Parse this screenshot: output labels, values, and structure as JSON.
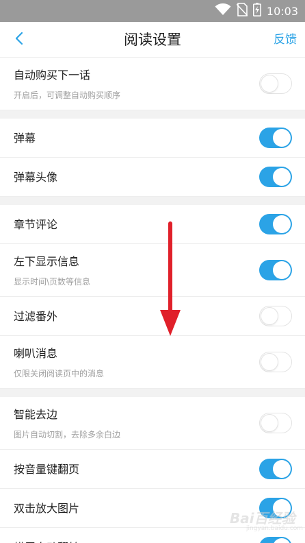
{
  "status_bar": {
    "time": "10:03",
    "icons": [
      "wifi-icon",
      "no-sim-icon",
      "battery-charging-icon"
    ]
  },
  "nav": {
    "back_icon": "chevron-left-icon",
    "title": "阅读设置",
    "feedback": "反馈"
  },
  "colors": {
    "accent": "#2ba3e6",
    "section_gap": "#f2f2f2",
    "status_bar": "#9a9a9a",
    "arrow": "#e0202a"
  },
  "settings": [
    {
      "label": "自动购买下一话",
      "sub": "开启后，可调整自动购买顺序",
      "on": false
    },
    {
      "label": "弹幕",
      "sub": "",
      "on": true
    },
    {
      "label": "弹幕头像",
      "sub": "",
      "on": true
    },
    {
      "label": "章节评论",
      "sub": "",
      "on": true
    },
    {
      "label": "左下显示信息",
      "sub": "显示时间\\页数等信息",
      "on": true
    },
    {
      "label": "过滤番外",
      "sub": "",
      "on": false
    },
    {
      "label": "喇叭消息",
      "sub": "仅限关闭阅读页中的消息",
      "on": false
    },
    {
      "label": "智能去边",
      "sub": "图片自动切割，去除多余白边",
      "on": false
    },
    {
      "label": "按音量键翻页",
      "sub": "",
      "on": true
    },
    {
      "label": "双击放大图片",
      "sub": "",
      "on": true
    },
    {
      "label": "横屏自动翻转",
      "sub": "",
      "on": true
    }
  ],
  "watermark": {
    "text": "Bai百经验",
    "sub": "jingyan.baidu.com"
  }
}
